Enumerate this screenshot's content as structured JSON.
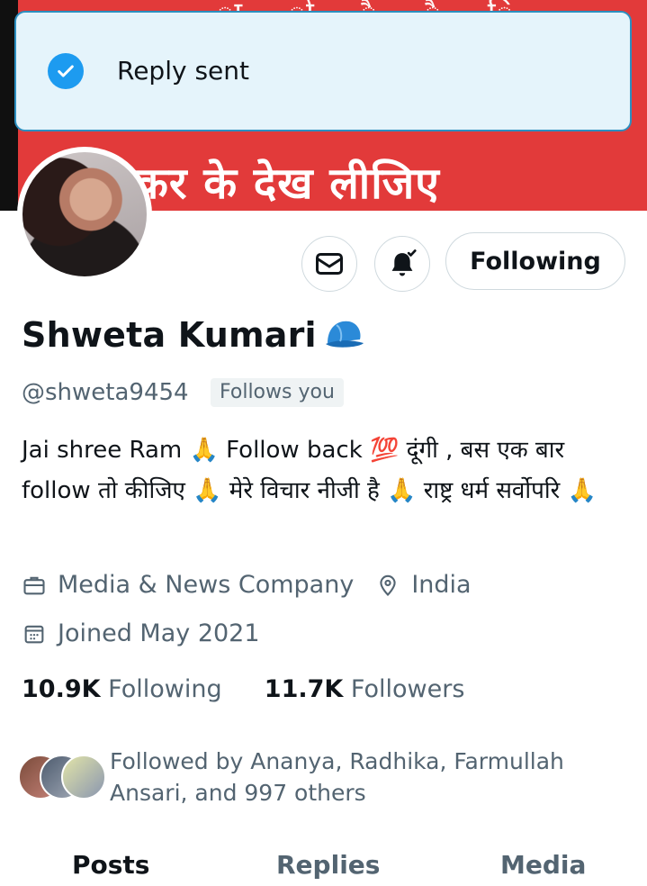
{
  "banner": {
    "text": "कर के देख लीजिए",
    "top_marks": "ा ो ै ै ि"
  },
  "toast": {
    "message": "Reply sent",
    "icon": "check-circle-icon"
  },
  "actions": {
    "message_icon": "mail-icon",
    "notification_icon": "bell-check-icon",
    "follow_label": "Following"
  },
  "profile": {
    "name": "Shweta Kumari",
    "name_emoji": "blue-cap-icon",
    "handle": "@shweta9454",
    "follows_you": "Follows you",
    "bio": "Jai shree Ram 🙏  Follow back 💯 दूंगी , बस एक बार follow तो कीजिए 🙏 मेरे विचार नीजी है 🙏  राष्ट्र धर्म सर्वोपरि 🙏",
    "category": "Media & News Company",
    "location": "India",
    "joined": "Joined May 2021"
  },
  "stats": {
    "following_count": "10.9K",
    "following_label": "Following",
    "followers_count": "11.7K",
    "followers_label": "Followers"
  },
  "followed_by": "Followed by Ananya, Radhika, Farmullah Ansari, and 997 others",
  "tabs": [
    {
      "label": "Posts"
    },
    {
      "label": "Replies"
    },
    {
      "label": "Media"
    }
  ],
  "colors": {
    "accent": "#1d9bf0",
    "secondary_text": "#536471",
    "banner": "#e23a3a"
  }
}
